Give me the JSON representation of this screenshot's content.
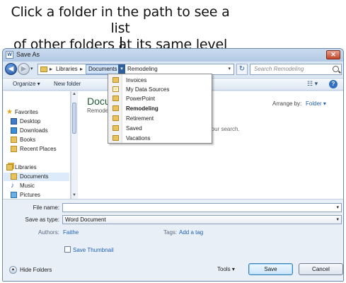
{
  "caption": {
    "line1": "Click a folder in the path to see a list",
    "line2": "of other folders at its same level"
  },
  "window": {
    "title": "Save As",
    "close_glyph": "✕"
  },
  "address_bar": {
    "breadcrumb": [
      "Libraries",
      "Documents"
    ],
    "current": "Remodeling",
    "separator_glyph": "▸",
    "dropdown_glyph": "▾"
  },
  "search": {
    "placeholder": "Search Remodeling"
  },
  "toolbar": {
    "organize": "Organize ▾",
    "new_folder": "New folder"
  },
  "nav_pane": {
    "items": [
      {
        "label": "Favorites",
        "icon": "star-icon"
      },
      {
        "label": "Desktop",
        "icon": "desktop-icon"
      },
      {
        "label": "Downloads",
        "icon": "downloads-icon"
      },
      {
        "label": "Books",
        "icon": "folder-icon"
      },
      {
        "label": "Recent Places",
        "icon": "recent-places-icon"
      },
      {
        "label": "Libraries",
        "icon": "libraries-icon"
      },
      {
        "label": "Documents",
        "icon": "documents-icon",
        "selected": true
      },
      {
        "label": "Music",
        "icon": "music-icon"
      },
      {
        "label": "Pictures",
        "icon": "pictures-icon"
      }
    ]
  },
  "content": {
    "title": "Docu",
    "subtitle": "Remode",
    "arrange_label": "Arrange by:",
    "arrange_value": "Folder ▾",
    "empty_message": "ch your search."
  },
  "folder_dropdown": {
    "items": [
      {
        "label": "Invoices"
      },
      {
        "label": "My Data Sources"
      },
      {
        "label": "PowerPoint"
      },
      {
        "label": "Remodeling",
        "current": true
      },
      {
        "label": "Retirement"
      },
      {
        "label": "Saved"
      },
      {
        "label": "Vacations"
      }
    ]
  },
  "form": {
    "file_name_label": "File name:",
    "file_name_value": "",
    "save_type_label": "Save as type:",
    "save_type_value": "Word Document",
    "authors_label": "Authors:",
    "authors_value": "Faithe",
    "tags_label": "Tags:",
    "tags_value": "Add a tag",
    "save_thumbnail_label": "Save Thumbnail",
    "save_thumbnail_checked": false
  },
  "footer": {
    "hide_folders": "Hide Folders",
    "tools": "Tools ▾",
    "save": "Save",
    "cancel": "Cancel"
  },
  "colors": {
    "window_border": "#6f8aa8",
    "accent_link": "#1f63b4",
    "library_title": "#1f5a33",
    "folder": "#e8c25b"
  }
}
